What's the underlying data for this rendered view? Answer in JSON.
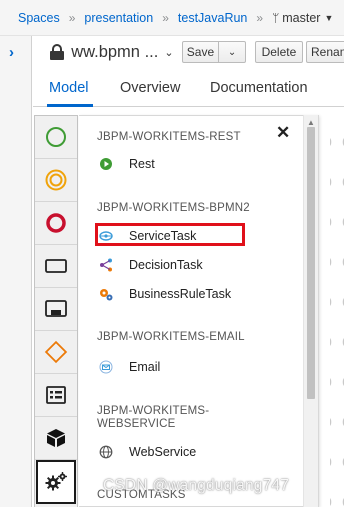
{
  "breadcrumb": {
    "items": [
      "Spaces",
      "presentation",
      "testJavaRun"
    ],
    "branch": "master"
  },
  "editor": {
    "title": "ww.bpmn ...",
    "save_label": "Save",
    "delete_label": "Delete",
    "rename_label": "Rename"
  },
  "tabs": {
    "model": "Model",
    "overview": "Overview",
    "documentation": "Documentation"
  },
  "palette": {
    "items": [
      {
        "name": "start-event",
        "icon": "green-circle"
      },
      {
        "name": "intermediate-event",
        "icon": "orange-double-circle"
      },
      {
        "name": "end-event",
        "icon": "red-thick-circle"
      },
      {
        "name": "task",
        "icon": "rectangle"
      },
      {
        "name": "subprocess",
        "icon": "collapsed-subprocess"
      },
      {
        "name": "gateway",
        "icon": "orange-diamond"
      },
      {
        "name": "data-object",
        "icon": "list-box"
      },
      {
        "name": "artifacts",
        "icon": "cube"
      },
      {
        "name": "custom-tasks",
        "icon": "gears"
      }
    ]
  },
  "flyout": {
    "groups": [
      {
        "title": "JBPM-WORKITEMS-REST",
        "items": [
          {
            "label": "Rest",
            "icon": "green-play-circle"
          }
        ]
      },
      {
        "title": "JBPM-WORKITEMS-BPMN2",
        "items": [
          {
            "label": "ServiceTask",
            "icon": "blue-service-icon"
          },
          {
            "label": "DecisionTask",
            "icon": "purple-decision-icon"
          },
          {
            "label": "BusinessRuleTask",
            "icon": "rule-gears-icon"
          }
        ]
      },
      {
        "title": "JBPM-WORKITEMS-EMAIL",
        "items": [
          {
            "label": "Email",
            "icon": "email-icon"
          }
        ]
      },
      {
        "title": "JBPM-WORKITEMS-WEBSERVICE",
        "items": [
          {
            "label": "WebService",
            "icon": "globe-icon"
          }
        ]
      },
      {
        "title": "CUSTOMTASKS",
        "items": []
      }
    ]
  },
  "watermark": "CSDN @wangduqiang747",
  "colors": {
    "accent": "#0066cc",
    "highlight": "#e0101a",
    "start_event": "#3f9c35",
    "intermediate_event": "#f0a30a",
    "end_event": "#c8102e",
    "gateway": "#ec7a08"
  }
}
